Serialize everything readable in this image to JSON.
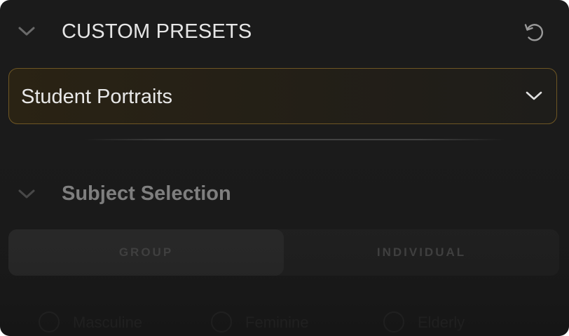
{
  "header": {
    "title": "CUSTOM PRESETS",
    "collapse_icon": "chevron-down-icon",
    "reset_icon": "reset-icon"
  },
  "preset_select": {
    "value": "Student Portraits",
    "icon": "chevron-down-icon"
  },
  "subject_selection": {
    "title": "Subject Selection",
    "collapse_icon": "chevron-down-icon",
    "segments": [
      {
        "label": "GROUP",
        "selected": true
      },
      {
        "label": "INDIVIDUAL",
        "selected": false
      }
    ],
    "options": [
      {
        "label": "Masculine"
      },
      {
        "label": "Feminine"
      },
      {
        "label": "Elderly"
      }
    ]
  },
  "colors": {
    "panel_bg": "#1b1b1b",
    "accent_border": "#6e5624",
    "title_text": "#e6e6e6",
    "muted_text": "#8a8a8a"
  }
}
